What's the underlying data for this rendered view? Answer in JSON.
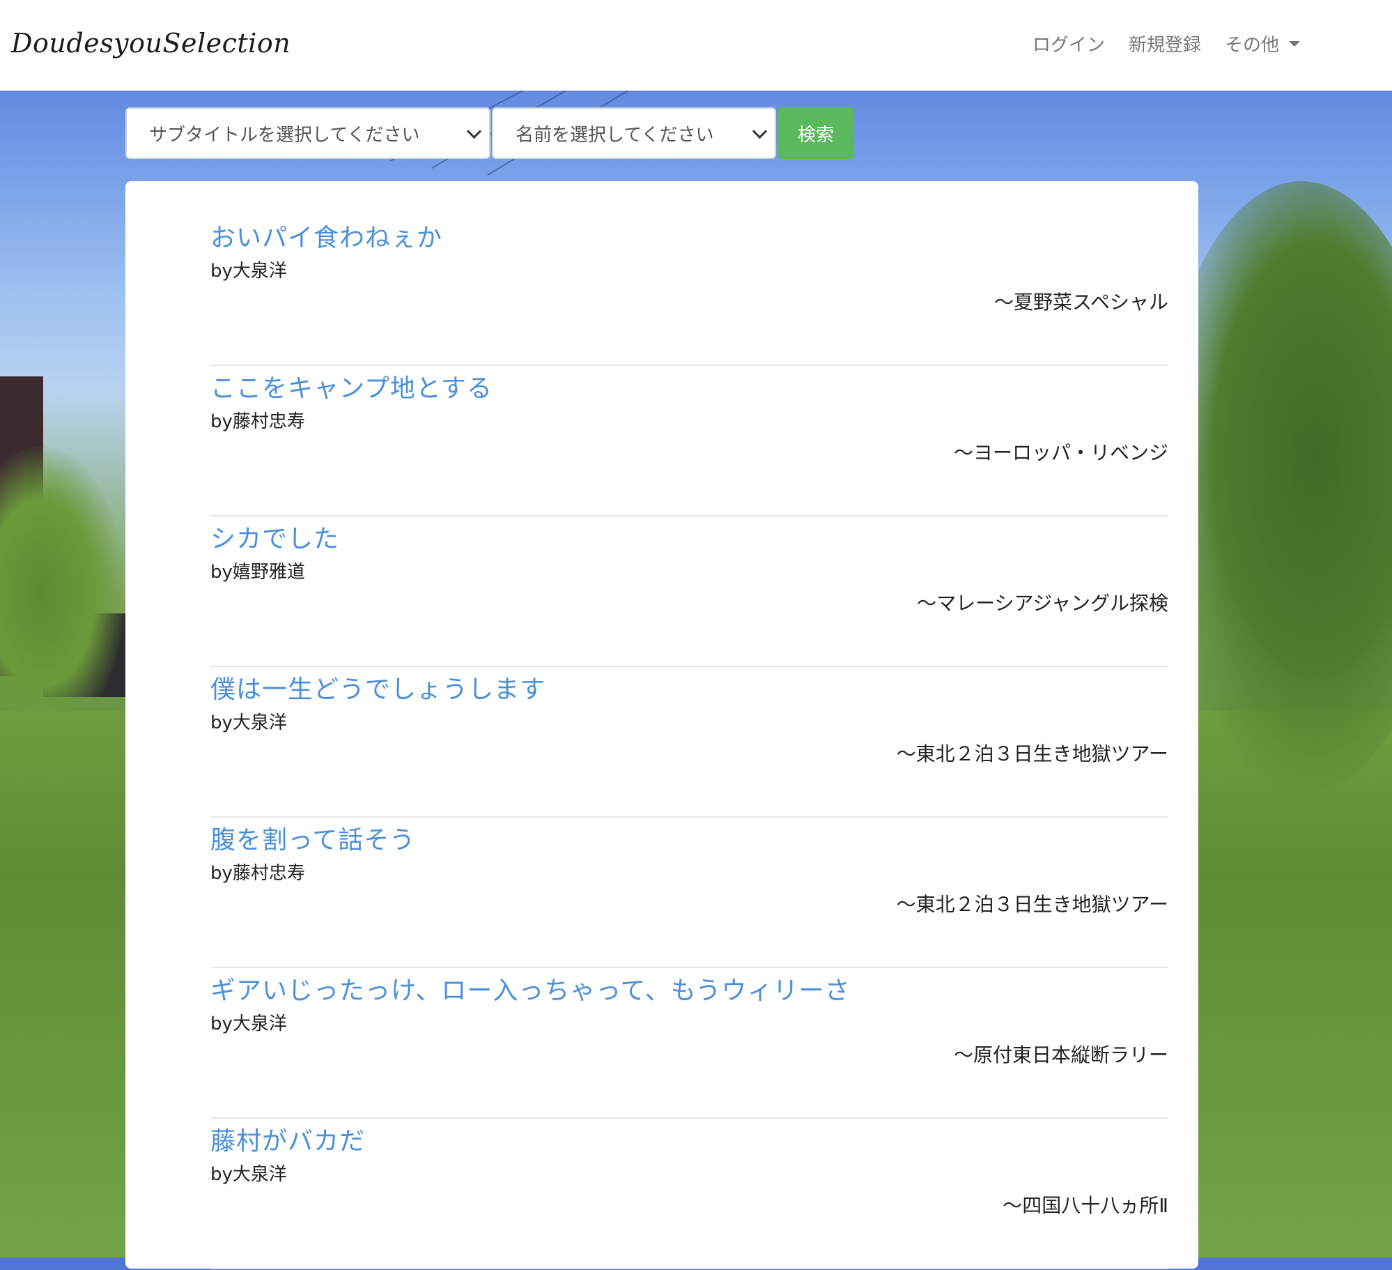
{
  "brand": "DoudesyouSelection",
  "nav": {
    "login": "ログイン",
    "register": "新規登録",
    "other": "その他"
  },
  "search": {
    "subtitle_placeholder": "サブタイトルを選択してください",
    "name_placeholder": "名前を選択してください",
    "button": "検索"
  },
  "colors": {
    "link": "#4a90d9",
    "search_button": "#5cb85c"
  },
  "quotes": [
    {
      "title": "おいパイ食わねぇか",
      "author": "by大泉洋",
      "subtitle": "〜夏野菜スペシャル"
    },
    {
      "title": "ここをキャンプ地とする",
      "author": "by藤村忠寿",
      "subtitle": "〜ヨーロッパ・リベンジ"
    },
    {
      "title": "シカでした",
      "author": "by嬉野雅道",
      "subtitle": "〜マレーシアジャングル探検"
    },
    {
      "title": "僕は一生どうでしょうします",
      "author": "by大泉洋",
      "subtitle": "〜東北２泊３日生き地獄ツアー"
    },
    {
      "title": "腹を割って話そう",
      "author": "by藤村忠寿",
      "subtitle": "〜東北２泊３日生き地獄ツアー"
    },
    {
      "title": "ギアいじったっけ、ロー入っちゃって、もうウィリーさ",
      "author": "by大泉洋",
      "subtitle": "〜原付東日本縦断ラリー"
    },
    {
      "title": "藤村がバカだ",
      "author": "by大泉洋",
      "subtitle": "〜四国八十八ヵ所Ⅱ"
    }
  ]
}
